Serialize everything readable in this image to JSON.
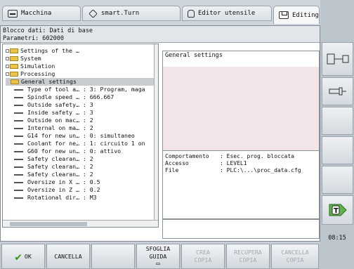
{
  "tabs": [
    {
      "label": "Macchina",
      "icon": "arrow-right-icon"
    },
    {
      "label": "smart.Turn",
      "icon": "diamond-icon"
    },
    {
      "label": "Editor utensile",
      "icon": "hand-icon"
    },
    {
      "label": "Editing",
      "icon": "save-icon"
    }
  ],
  "header": {
    "line1": "Blocco dati: Dati di base",
    "line2": "Parametri: 602000"
  },
  "tree": [
    {
      "label": "Settings of the …",
      "kind": "folder-plus"
    },
    {
      "label": "System",
      "kind": "folder-plus"
    },
    {
      "label": "Simulation",
      "kind": "folder-plus"
    },
    {
      "label": "Processing",
      "kind": "folder-plus"
    },
    {
      "label": "General settings",
      "kind": "folder-open"
    },
    {
      "label": "Type of tool a… : 3: Program, maga",
      "kind": "param"
    },
    {
      "label": "Spindle speed … : 666.667",
      "kind": "param"
    },
    {
      "label": "Outside safety… : 3",
      "kind": "param"
    },
    {
      "label": "Inside safety … : 3",
      "kind": "param"
    },
    {
      "label": "Outside on mac… : 2",
      "kind": "param"
    },
    {
      "label": "Internal on ma… : 2",
      "kind": "param"
    },
    {
      "label": "G14 for new un… : 0: simultaneo",
      "kind": "param"
    },
    {
      "label": "Coolant for ne… : 1: circuito 1 on",
      "kind": "param"
    },
    {
      "label": "G60 for new un… : 0: attivo",
      "kind": "param"
    },
    {
      "label": "Safety clearan… : 2",
      "kind": "param"
    },
    {
      "label": "Safety clearan… : 2",
      "kind": "param"
    },
    {
      "label": "Safety clearan… : 2",
      "kind": "param"
    },
    {
      "label": "Oversize in X … : 0.5",
      "kind": "param"
    },
    {
      "label": "Oversize in Z … : 0.2",
      "kind": "param"
    },
    {
      "label": "Rotational dir… : M3",
      "kind": "param"
    }
  ],
  "description": {
    "title": "General settings"
  },
  "info": [
    {
      "key": "Comportamento",
      "value": ": Esec. prog. bloccata"
    },
    {
      "key": "Accesso",
      "value": ": LEVEL1"
    },
    {
      "key": "File",
      "value": ": PLC:\\...\\proc_data.cfg"
    }
  ],
  "clock": "08:15",
  "softkeys": [
    {
      "label": "OK",
      "enabled": true
    },
    {
      "label": "CANCELLA",
      "enabled": true
    },
    {
      "label": "",
      "enabled": false
    },
    {
      "label": "SFOGLIA GUIDA",
      "enabled": true
    },
    {
      "label": "CREA COPIA",
      "enabled": false
    },
    {
      "label": "RECUPERA COPIA",
      "enabled": false
    },
    {
      "label": "CANCELLA COPIA",
      "enabled": false
    }
  ]
}
